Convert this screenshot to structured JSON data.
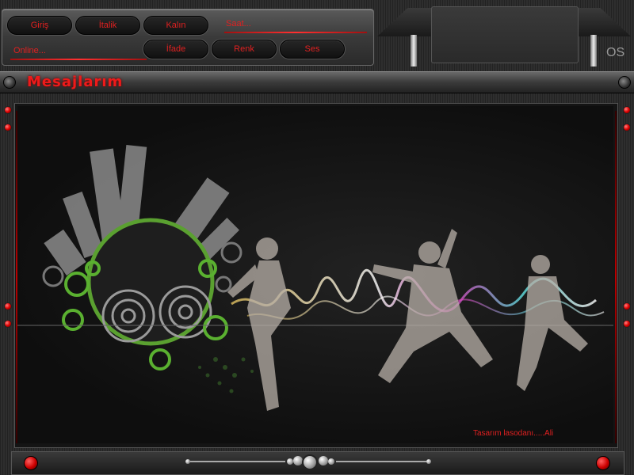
{
  "toolbar": {
    "buttons": {
      "gris": "Giriş",
      "italik": "İtalik",
      "kalin": "Kalın",
      "ifade": "İfade",
      "renk": "Renk",
      "ses": "Ses"
    },
    "saat_label": "Saat...",
    "online_label": "Online..."
  },
  "brand_mark": "OS",
  "title": "Mesajlarım",
  "credit": "Tasarım lasodanı.....Ali",
  "colors": {
    "accent": "#e02020",
    "panel": "#3a3a3a",
    "background": "#1a1a1a"
  },
  "icons": {
    "left_knob": "knob-icon",
    "right_knob": "knob-icon",
    "led": "led-icon",
    "footer_left": "record-icon",
    "footer_right": "record-icon",
    "center_dial": "dial-icon"
  }
}
